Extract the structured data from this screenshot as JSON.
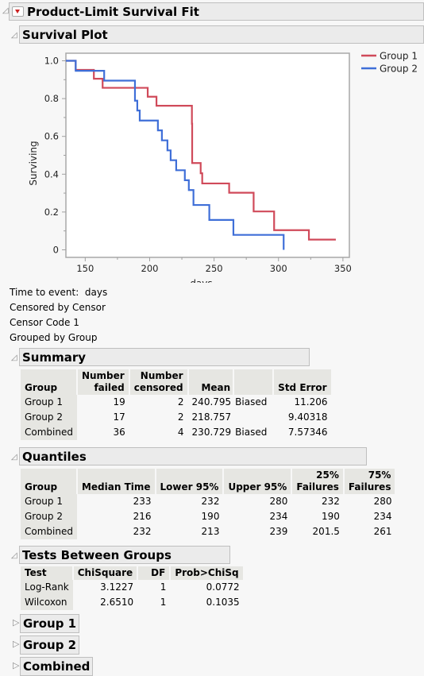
{
  "report": {
    "title": "Product-Limit Survival Fit",
    "plot_section_title": "Survival Plot",
    "info": {
      "time_to_event_label": "Time to event:",
      "time_to_event_value": "days",
      "censored_by_label": "Censored by",
      "censored_by_value": "Censor",
      "censor_code_label": "Censor Code",
      "censor_code_value": "1",
      "grouped_by_label": "Grouped by",
      "grouped_by_value": "Group"
    }
  },
  "chart_data": {
    "type": "line",
    "subtype": "step",
    "title": "Survival Plot",
    "xlabel": "days",
    "ylabel": "Surviving",
    "xlim": [
      135,
      355
    ],
    "ylim": [
      -0.04,
      1.04
    ],
    "xticks": [
      150,
      200,
      250,
      300,
      350
    ],
    "xtick_labels": [
      "150",
      "200",
      "250",
      "300",
      "350"
    ],
    "yticks": [
      0,
      0.2,
      0.4,
      0.6,
      0.8,
      1.0
    ],
    "ytick_labels": [
      "0",
      "0.2",
      "0.4",
      "0.6",
      "0.8",
      "1.0"
    ],
    "grid": false,
    "legend_position": "right",
    "series": [
      {
        "name": "Group 1",
        "color": "#d04a5a",
        "start_x": 135,
        "steps": [
          [
            142.6,
            0.952
          ],
          [
            156.7,
            0.905
          ],
          [
            163.5,
            0.857
          ],
          [
            198.5,
            0.81
          ],
          [
            205.3,
            0.762
          ],
          [
            232.8,
            0.667
          ],
          [
            233.0,
            0.459
          ],
          [
            239.6,
            0.405
          ],
          [
            240.8,
            0.351
          ],
          [
            261.7,
            0.302
          ],
          [
            280.7,
            0.203
          ],
          [
            296.6,
            0.104
          ],
          [
            323.6,
            0.054
          ]
        ],
        "end_x": 344.5
      },
      {
        "name": "Group 2",
        "color": "#3f6fd8",
        "start_x": 135,
        "steps": [
          [
            142.6,
            0.947
          ],
          [
            164.7,
            0.895
          ],
          [
            188.6,
            0.789
          ],
          [
            190.4,
            0.737
          ],
          [
            192.3,
            0.684
          ],
          [
            206.4,
            0.632
          ],
          [
            209.5,
            0.579
          ],
          [
            213.8,
            0.526
          ],
          [
            216.3,
            0.474
          ],
          [
            220.6,
            0.421
          ],
          [
            227.3,
            0.368
          ],
          [
            230.4,
            0.316
          ],
          [
            234.0,
            0.237
          ],
          [
            246.3,
            0.158
          ],
          [
            265.0,
            0.079
          ],
          [
            304.0,
            0.0
          ]
        ],
        "end_x": 304.0
      }
    ]
  },
  "summary": {
    "title": "Summary",
    "headers": [
      "Group",
      "Number failed",
      "Number censored",
      "Mean",
      "",
      "Std Error"
    ],
    "header_lines": [
      [
        "",
        "Number",
        "Number",
        "",
        "",
        ""
      ],
      [
        "Group",
        "failed",
        "censored",
        "Mean",
        "",
        "Std Error"
      ]
    ],
    "rows": [
      [
        "Group 1",
        "19",
        "2",
        "240.795",
        "Biased",
        "11.206"
      ],
      [
        "Group 2",
        "17",
        "2",
        "218.757",
        "",
        "9.40318"
      ],
      [
        "Combined",
        "36",
        "4",
        "230.729",
        "Biased",
        "7.57346"
      ]
    ]
  },
  "quantiles": {
    "title": "Quantiles",
    "header_lines": [
      [
        "",
        "",
        "",
        "",
        "25%",
        "75%"
      ],
      [
        "Group",
        "Median Time",
        "Lower 95%",
        "Upper 95%",
        "Failures",
        "Failures"
      ]
    ],
    "rows": [
      [
        "Group 1",
        "233",
        "232",
        "280",
        "232",
        "280"
      ],
      [
        "Group 2",
        "216",
        "190",
        "234",
        "190",
        "234"
      ],
      [
        "Combined",
        "232",
        "213",
        "239",
        "201.5",
        "261"
      ]
    ]
  },
  "tests": {
    "title": "Tests Between Groups",
    "headers": [
      "Test",
      "ChiSquare",
      "DF",
      "Prob>ChiSq"
    ],
    "rows": [
      [
        "Log-Rank",
        "3.1227",
        "1",
        "0.0772"
      ],
      [
        "Wilcoxon",
        "2.6510",
        "1",
        "0.1035"
      ]
    ]
  },
  "collapsed_sections": [
    "Group 1",
    "Group 2",
    "Combined"
  ]
}
